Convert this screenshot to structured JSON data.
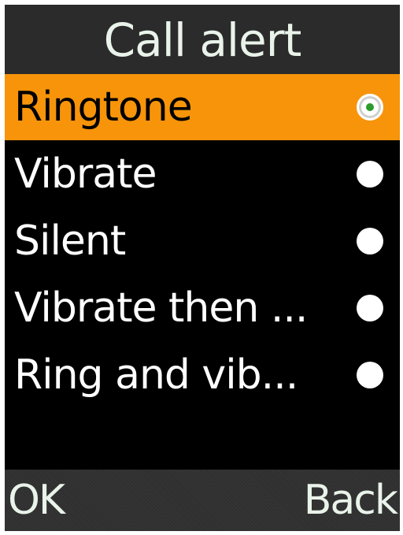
{
  "header": {
    "title": "Call alert"
  },
  "options": [
    {
      "label": "Ringtone",
      "selected": true
    },
    {
      "label": "Vibrate",
      "selected": false
    },
    {
      "label": "Silent",
      "selected": false
    },
    {
      "label": "Vibrate then ...",
      "selected": false
    },
    {
      "label": "Ring and vib...",
      "selected": false
    }
  ],
  "softkeys": {
    "left": "OK",
    "right": "Back"
  },
  "colors": {
    "highlight": "#f7940a",
    "background": "#000000",
    "title_bar": "#2b2b2b",
    "radio_dot": "#2c9a2c"
  },
  "icons": {
    "radio_selected": "radio-selected-icon",
    "radio_unselected": "radio-unselected-icon"
  }
}
